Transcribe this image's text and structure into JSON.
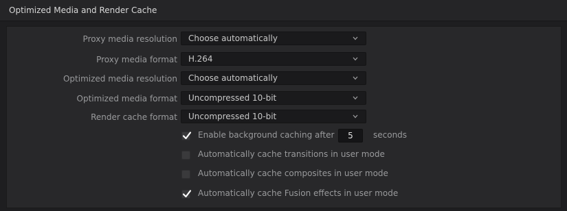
{
  "section": {
    "title": "Optimized Media and Render Cache"
  },
  "settings": [
    {
      "label": "Proxy media resolution",
      "value": "Choose automatically"
    },
    {
      "label": "Proxy media format",
      "value": "H.264"
    },
    {
      "label": "Optimized media resolution",
      "value": "Choose automatically"
    },
    {
      "label": "Optimized media format",
      "value": "Uncompressed 10-bit"
    },
    {
      "label": "Render cache format",
      "value": "Uncompressed 10-bit"
    }
  ],
  "options": [
    {
      "label": "Enable background caching after",
      "checked": true
    },
    {
      "label": "Automatically cache transitions in user mode",
      "checked": false
    },
    {
      "label": "Automatically cache composites in user mode",
      "checked": false
    },
    {
      "label": "Automatically cache Fusion effects in user mode",
      "checked": true
    }
  ],
  "background_caching": {
    "delay_value": "5",
    "unit": "seconds"
  },
  "icons": {
    "dropdown": "chevron-down-icon",
    "check": "checkmark-icon"
  },
  "colors": {
    "panel_bg": "#28282a",
    "dropdown_bg": "#1a1a1c",
    "label_text": "#999a9c",
    "value_text": "#c8c8c8"
  }
}
